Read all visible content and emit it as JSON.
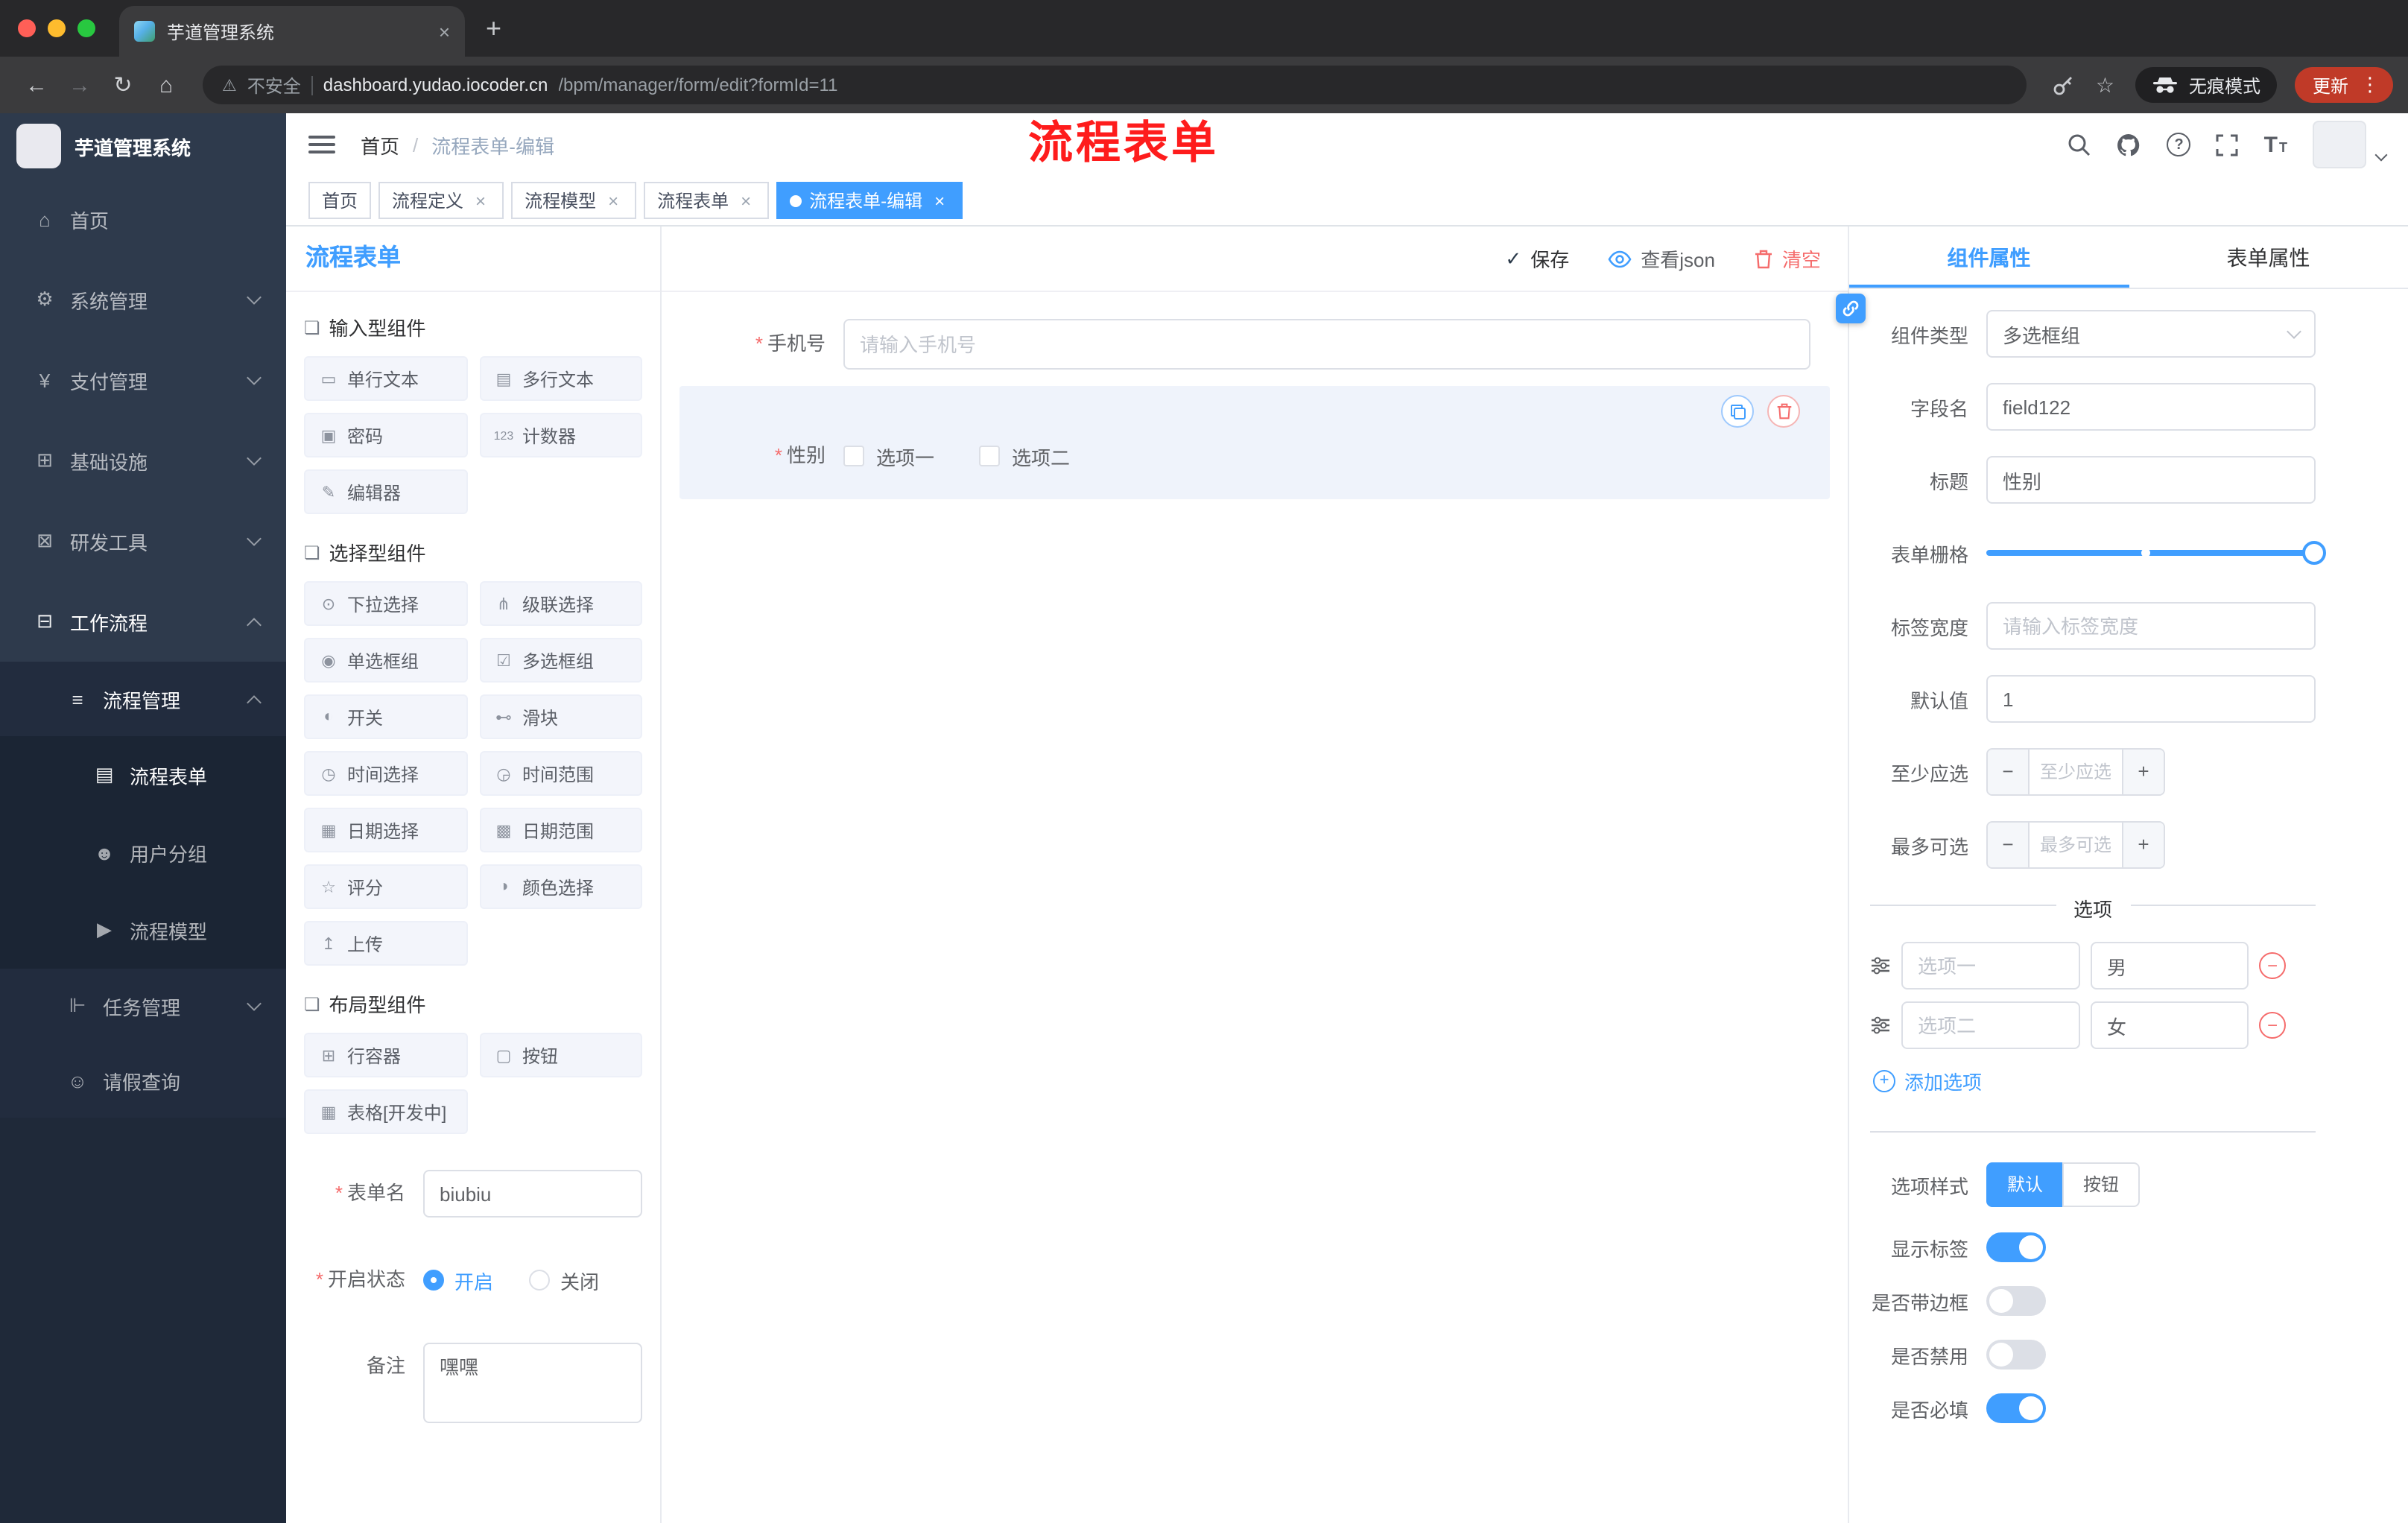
{
  "glyphs": {
    "close": "×",
    "plus": "+",
    "check": "✓",
    "star": "☆",
    "back": "←",
    "forward": "→",
    "reload": "↻",
    "home": "⌂",
    "warning": "⚠",
    "kebab": "⋮",
    "slash": "/",
    "minus": "−",
    "question": "?",
    "asterisk": "*",
    "font": "T",
    "group": "❏"
  },
  "browser": {
    "tab": {
      "title": "芋道管理系统"
    },
    "url": {
      "security": "不安全",
      "domain": "dashboard.yudao.iocoder.cn",
      "path": "/bpm/manager/form/edit?formId=11"
    },
    "incognito": "无痕模式",
    "update": "更新"
  },
  "sidebar": {
    "logo": "芋道管理系统",
    "items": [
      {
        "label": "首页",
        "glyph": "⌂"
      },
      {
        "label": "系统管理",
        "glyph": "⚙"
      },
      {
        "label": "支付管理",
        "glyph": "¥"
      },
      {
        "label": "基础设施",
        "glyph": "⊞"
      },
      {
        "label": "研发工具",
        "glyph": "⊠"
      },
      {
        "label": "工作流程",
        "glyph": "⊟"
      },
      {
        "label": "流程管理",
        "glyph": "≡"
      },
      {
        "label": "流程表单",
        "glyph": "▤"
      },
      {
        "label": "用户分组",
        "glyph": "☻"
      },
      {
        "label": "流程模型",
        "glyph": "▶"
      },
      {
        "label": "任务管理",
        "glyph": "⊩"
      },
      {
        "label": "请假查询",
        "glyph": "☺"
      }
    ]
  },
  "header": {
    "breadcrumb_home": "首页",
    "breadcrumb_current": "流程表单-编辑",
    "annotation": "流程表单"
  },
  "tags": [
    {
      "label": "首页"
    },
    {
      "label": "流程定义"
    },
    {
      "label": "流程模型"
    },
    {
      "label": "流程表单"
    },
    {
      "label": "流程表单-编辑"
    }
  ],
  "designer": {
    "panel_title": "流程表单",
    "groups": [
      {
        "title": "输入型组件",
        "items": [
          {
            "label": "单行文本",
            "glyph": "▭"
          },
          {
            "label": "多行文本",
            "glyph": "▤"
          },
          {
            "label": "密码",
            "glyph": "▣"
          },
          {
            "label": "计数器",
            "glyph": "123"
          },
          {
            "label": "编辑器",
            "glyph": "✎"
          }
        ]
      },
      {
        "title": "选择型组件",
        "items": [
          {
            "label": "下拉选择",
            "glyph": "⊙"
          },
          {
            "label": "级联选择",
            "glyph": "⋔"
          },
          {
            "label": "单选框组",
            "glyph": "◉"
          },
          {
            "label": "多选框组",
            "glyph": "☑"
          },
          {
            "label": "开关",
            "glyph": "◐"
          },
          {
            "label": "滑块",
            "glyph": "⊷"
          },
          {
            "label": "时间选择",
            "glyph": "◷"
          },
          {
            "label": "时间范围",
            "glyph": "◶"
          },
          {
            "label": "日期选择",
            "glyph": "▦"
          },
          {
            "label": "日期范围",
            "glyph": "▩"
          },
          {
            "label": "评分",
            "glyph": "☆"
          },
          {
            "label": "颜色选择",
            "glyph": "◑"
          },
          {
            "label": "上传",
            "glyph": "↥"
          }
        ]
      },
      {
        "title": "布局型组件",
        "items": [
          {
            "label": "行容器",
            "glyph": "⊞"
          },
          {
            "label": "按钮",
            "glyph": "▢"
          },
          {
            "label": "表格[开发中]",
            "glyph": "▦"
          }
        ]
      }
    ],
    "settings": {
      "name_label": "表单名",
      "name_value": "biubiu",
      "status_label": "开启状态",
      "status_on": "开启",
      "status_off": "关闭",
      "remark_label": "备注",
      "remark_value": "嘿嘿"
    }
  },
  "canvas": {
    "save": "保存",
    "view_json": "查看json",
    "clear": "清空",
    "phone": {
      "label": "手机号",
      "placeholder": "请输入手机号"
    },
    "gender": {
      "label": "性别",
      "option1": "选项一",
      "option2": "选项二"
    }
  },
  "props": {
    "tab_component": "组件属性",
    "tab_form": "表单属性",
    "component_type_label": "组件类型",
    "component_type_value": "多选框组",
    "field_label": "字段名",
    "field_value": "field122",
    "title_label": "标题",
    "title_value": "性别",
    "grid_label": "表单栅格",
    "label_width_label": "标签宽度",
    "label_width_placeholder": "请输入标签宽度",
    "default_label": "默认值",
    "default_value": "1",
    "min_label": "至少应选",
    "min_placeholder": "至少应选",
    "max_label": "最多可选",
    "max_placeholder": "最多可选",
    "options_title": "选项",
    "options": [
      {
        "label": "选项一",
        "value": "男"
      },
      {
        "label": "选项二",
        "value": "女"
      }
    ],
    "add_option": "添加选项",
    "style_label": "选项样式",
    "style_default": "默认",
    "style_button": "按钮",
    "toggle_show_label": "显示标签",
    "toggle_border": "是否带边框",
    "toggle_disabled": "是否禁用",
    "toggle_required": "是否必填"
  },
  "colors": {
    "accent": "#409eff",
    "danger": "#f56c6c",
    "annotation_red": "#fe1c1c",
    "sidebar_bg": "#2e3a4c",
    "update_chip": "#c03a28"
  }
}
